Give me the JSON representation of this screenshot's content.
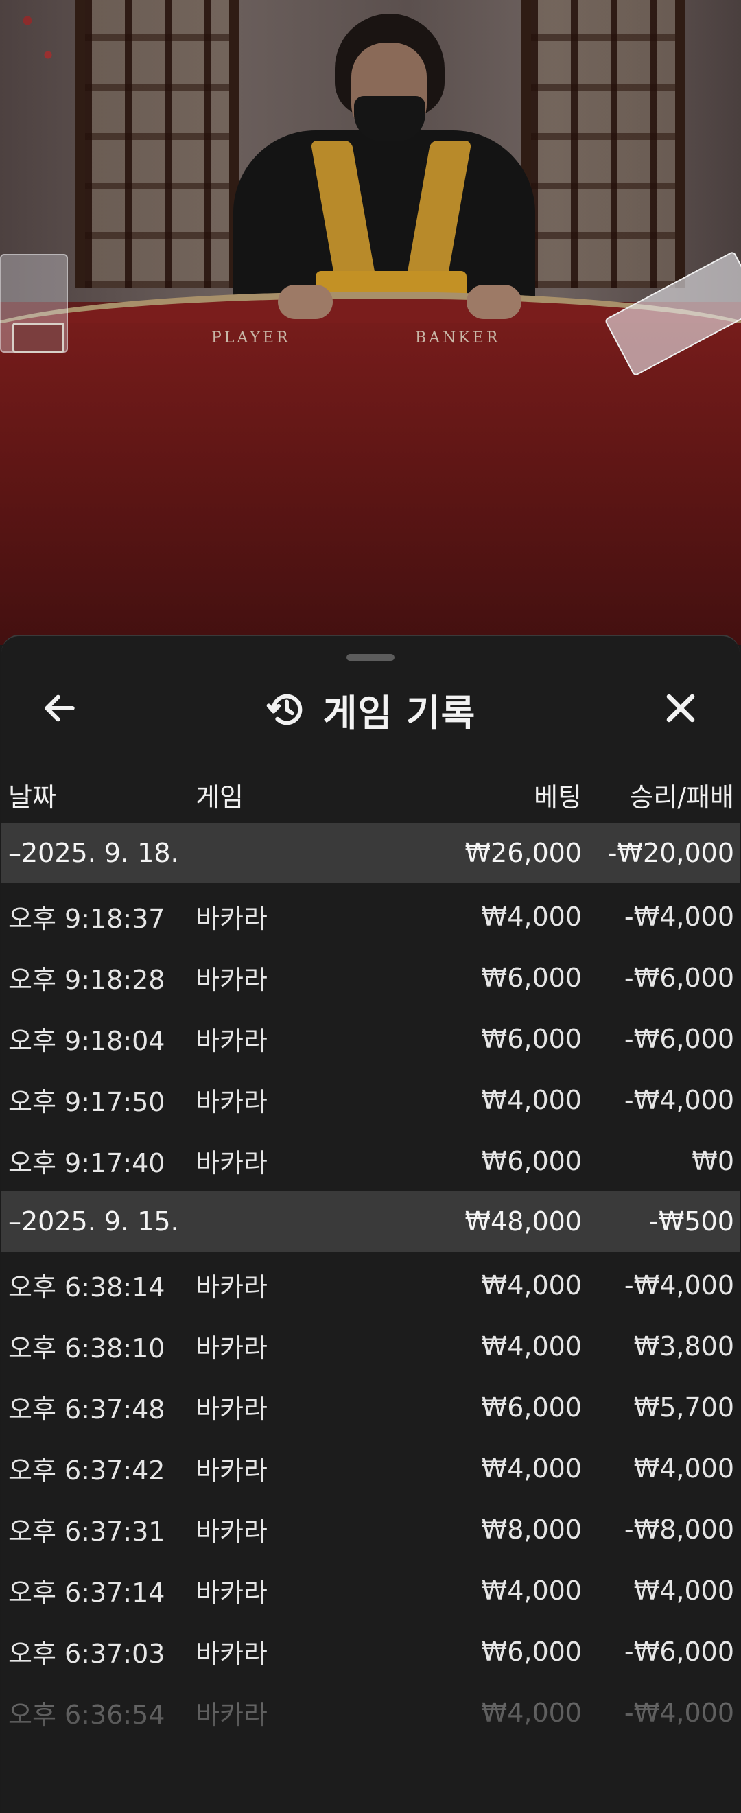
{
  "video": {
    "felt_labels": {
      "player": "PLAYER",
      "banker": "BANKER"
    }
  },
  "sheet": {
    "title": "게임 기록",
    "title_icon": "history-icon",
    "back_icon": "arrow-left-icon",
    "close_icon": "close-icon"
  },
  "columns": {
    "date": "날짜",
    "game": "게임",
    "bet": "베팅",
    "result": "승리/패배"
  },
  "groups": [
    {
      "date": "–2025. 9. 18.",
      "bet": "₩26,000",
      "result": "-₩20,000",
      "rows": [
        {
          "time": "오후 9:18:37",
          "game": "바카라",
          "bet": "₩4,000",
          "result": "-₩4,000"
        },
        {
          "time": "오후 9:18:28",
          "game": "바카라",
          "bet": "₩6,000",
          "result": "-₩6,000"
        },
        {
          "time": "오후 9:18:04",
          "game": "바카라",
          "bet": "₩6,000",
          "result": "-₩6,000"
        },
        {
          "time": "오후 9:17:50",
          "game": "바카라",
          "bet": "₩4,000",
          "result": "-₩4,000"
        },
        {
          "time": "오후 9:17:40",
          "game": "바카라",
          "bet": "₩6,000",
          "result": "₩0"
        }
      ]
    },
    {
      "date": "–2025. 9. 15.",
      "bet": "₩48,000",
      "result": "-₩500",
      "rows": [
        {
          "time": "오후 6:38:14",
          "game": "바카라",
          "bet": "₩4,000",
          "result": "-₩4,000"
        },
        {
          "time": "오후 6:38:10",
          "game": "바카라",
          "bet": "₩4,000",
          "result": "₩3,800"
        },
        {
          "time": "오후 6:37:48",
          "game": "바카라",
          "bet": "₩6,000",
          "result": "₩5,700"
        },
        {
          "time": "오후 6:37:42",
          "game": "바카라",
          "bet": "₩4,000",
          "result": "₩4,000"
        },
        {
          "time": "오후 6:37:31",
          "game": "바카라",
          "bet": "₩8,000",
          "result": "-₩8,000"
        },
        {
          "time": "오후 6:37:14",
          "game": "바카라",
          "bet": "₩4,000",
          "result": "₩4,000"
        },
        {
          "time": "오후 6:37:03",
          "game": "바카라",
          "bet": "₩6,000",
          "result": "-₩6,000"
        },
        {
          "time": "오후 6:36:54",
          "game": "바카라",
          "bet": "₩4,000",
          "result": "-₩4,000"
        }
      ]
    }
  ]
}
